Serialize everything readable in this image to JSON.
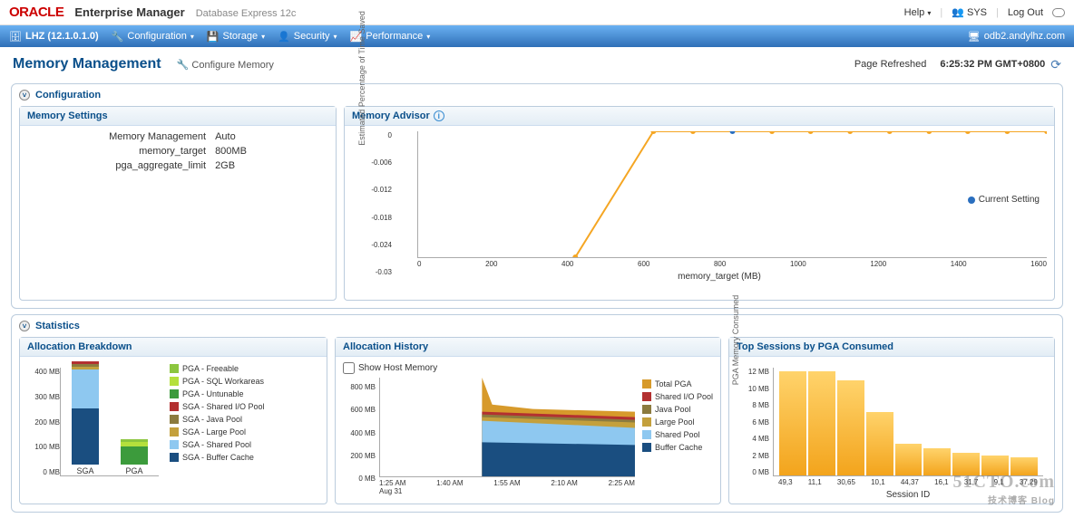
{
  "header": {
    "logo": "ORACLE",
    "title": "Enterprise Manager",
    "subtitle": "Database Express 12c",
    "help": "Help",
    "user": "SYS",
    "logout": "Log Out"
  },
  "nav": {
    "db": "LHZ (12.1.0.1.0)",
    "items": [
      "Configuration",
      "Storage",
      "Security",
      "Performance"
    ],
    "host": "odb2.andylhz.com"
  },
  "page": {
    "title": "Memory Management",
    "configure": "Configure Memory",
    "refreshed_label": "Page Refreshed",
    "refreshed_time": "6:25:32 PM GMT+0800"
  },
  "configuration": {
    "heading": "Configuration",
    "memory_settings": {
      "title": "Memory Settings",
      "rows": [
        {
          "k": "Memory Management",
          "v": "Auto"
        },
        {
          "k": "memory_target",
          "v": "800MB"
        },
        {
          "k": "pga_aggregate_limit",
          "v": "2GB"
        }
      ]
    },
    "memory_advisor": {
      "title": "Memory Advisor",
      "ylabel": "Estimated Percentage of Time Saved",
      "xlabel": "memory_target (MB)",
      "legend": "Current Setting",
      "yticks": [
        "0",
        "-0.006",
        "-0.012",
        "-0.018",
        "-0.024",
        "-0.03"
      ],
      "xticks": [
        "0",
        "200",
        "400",
        "600",
        "800",
        "1000",
        "1200",
        "1400",
        "1600"
      ]
    }
  },
  "statistics": {
    "heading": "Statistics",
    "allocation_breakdown": {
      "title": "Allocation Breakdown",
      "yticks": [
        "400 MB",
        "300 MB",
        "200 MB",
        "100 MB",
        "0 MB"
      ],
      "categories": [
        "SGA",
        "PGA"
      ],
      "legend": [
        {
          "label": "PGA - Freeable",
          "color": "#8cc63f"
        },
        {
          "label": "PGA - SQL Workareas",
          "color": "#b5e03c"
        },
        {
          "label": "PGA - Untunable",
          "color": "#3c9b3c"
        },
        {
          "label": "SGA - Shared I/O Pool",
          "color": "#b33030"
        },
        {
          "label": "SGA - Java Pool",
          "color": "#8c7b3f"
        },
        {
          "label": "SGA - Large Pool",
          "color": "#c4a03c"
        },
        {
          "label": "SGA - Shared Pool",
          "color": "#8ec8f0"
        },
        {
          "label": "SGA - Buffer Cache",
          "color": "#1a4e80"
        }
      ]
    },
    "allocation_history": {
      "title": "Allocation History",
      "show_host": "Show Host Memory",
      "yticks": [
        "800 MB",
        "600 MB",
        "400 MB",
        "200 MB",
        "0 MB"
      ],
      "xticks": [
        "1:25 AM",
        "1:40 AM",
        "1:55 AM",
        "2:10 AM",
        "2:25 AM"
      ],
      "date": "Aug 31",
      "legend": [
        {
          "label": "Total PGA",
          "color": "#d79a2b"
        },
        {
          "label": "Shared I/O Pool",
          "color": "#b33030"
        },
        {
          "label": "Java Pool",
          "color": "#8c7b3f"
        },
        {
          "label": "Large Pool",
          "color": "#c4a03c"
        },
        {
          "label": "Shared Pool",
          "color": "#8ec8f0"
        },
        {
          "label": "Buffer Cache",
          "color": "#1a4e80"
        }
      ]
    },
    "top_sessions": {
      "title": "Top Sessions by PGA Consumed",
      "ylabel": "PGA Memory Consumed",
      "xlabel": "Session ID",
      "yticks": [
        "12 MB",
        "10 MB",
        "8 MB",
        "6 MB",
        "4 MB",
        "2 MB",
        "0 MB"
      ],
      "sessions": [
        "49,3",
        "11,1",
        "30,65",
        "10,1",
        "44,37",
        "16,1",
        "31,7",
        "9,1",
        "37,29"
      ]
    }
  },
  "chart_data": [
    {
      "type": "line",
      "title": "Memory Advisor",
      "xlabel": "memory_target (MB)",
      "ylabel": "Estimated Percentage of Time Saved",
      "x": [
        400,
        600,
        700,
        800,
        900,
        1000,
        1100,
        1200,
        1300,
        1400,
        1500,
        1600
      ],
      "y": [
        -0.03,
        0,
        0,
        0,
        0,
        0,
        0,
        0,
        0,
        0,
        0,
        0
      ],
      "current_setting_x": 800,
      "xlim": [
        0,
        1600
      ],
      "ylim": [
        -0.03,
        0
      ]
    },
    {
      "type": "bar",
      "title": "Allocation Breakdown",
      "categories": [
        "SGA",
        "PGA"
      ],
      "series": [
        {
          "name": "Buffer Cache",
          "values": [
            260,
            0
          ]
        },
        {
          "name": "Shared Pool",
          "values": [
            180,
            0
          ]
        },
        {
          "name": "Large Pool",
          "values": [
            4,
            0
          ]
        },
        {
          "name": "Java Pool",
          "values": [
            4,
            0
          ]
        },
        {
          "name": "Shared I/O Pool",
          "values": [
            4,
            0
          ]
        },
        {
          "name": "PGA - Untunable",
          "values": [
            0,
            80
          ]
        },
        {
          "name": "PGA - SQL Workareas",
          "values": [
            0,
            20
          ]
        },
        {
          "name": "PGA - Freeable",
          "values": [
            0,
            10
          ]
        }
      ],
      "ylabel": "MB",
      "ylim": [
        0,
        450
      ]
    },
    {
      "type": "area",
      "title": "Allocation History",
      "x": [
        "1:25 AM",
        "1:40 AM",
        "1:55 AM",
        "2:10 AM",
        "2:25 AM"
      ],
      "series": [
        {
          "name": "Buffer Cache",
          "values": [
            0,
            0,
            260,
            260,
            260
          ]
        },
        {
          "name": "Shared Pool",
          "values": [
            0,
            0,
            180,
            180,
            180
          ]
        },
        {
          "name": "Large Pool",
          "values": [
            0,
            0,
            20,
            20,
            20
          ]
        },
        {
          "name": "Java Pool",
          "values": [
            0,
            0,
            20,
            20,
            20
          ]
        },
        {
          "name": "Shared I/O Pool",
          "values": [
            0,
            0,
            20,
            20,
            20
          ]
        },
        {
          "name": "Total PGA",
          "values": [
            0,
            0,
            800,
            560,
            530
          ]
        }
      ],
      "ylabel": "MB",
      "ylim": [
        0,
        800
      ]
    },
    {
      "type": "bar",
      "title": "Top Sessions by PGA Consumed",
      "categories": [
        "49,3",
        "11,1",
        "30,65",
        "10,1",
        "44,37",
        "16,1",
        "31,7",
        "9,1",
        "37,29"
      ],
      "values": [
        11.5,
        11.5,
        10.5,
        7,
        3.5,
        3,
        2.5,
        2.2,
        2
      ],
      "xlabel": "Session ID",
      "ylabel": "PGA Memory Consumed (MB)",
      "ylim": [
        0,
        12
      ]
    }
  ]
}
